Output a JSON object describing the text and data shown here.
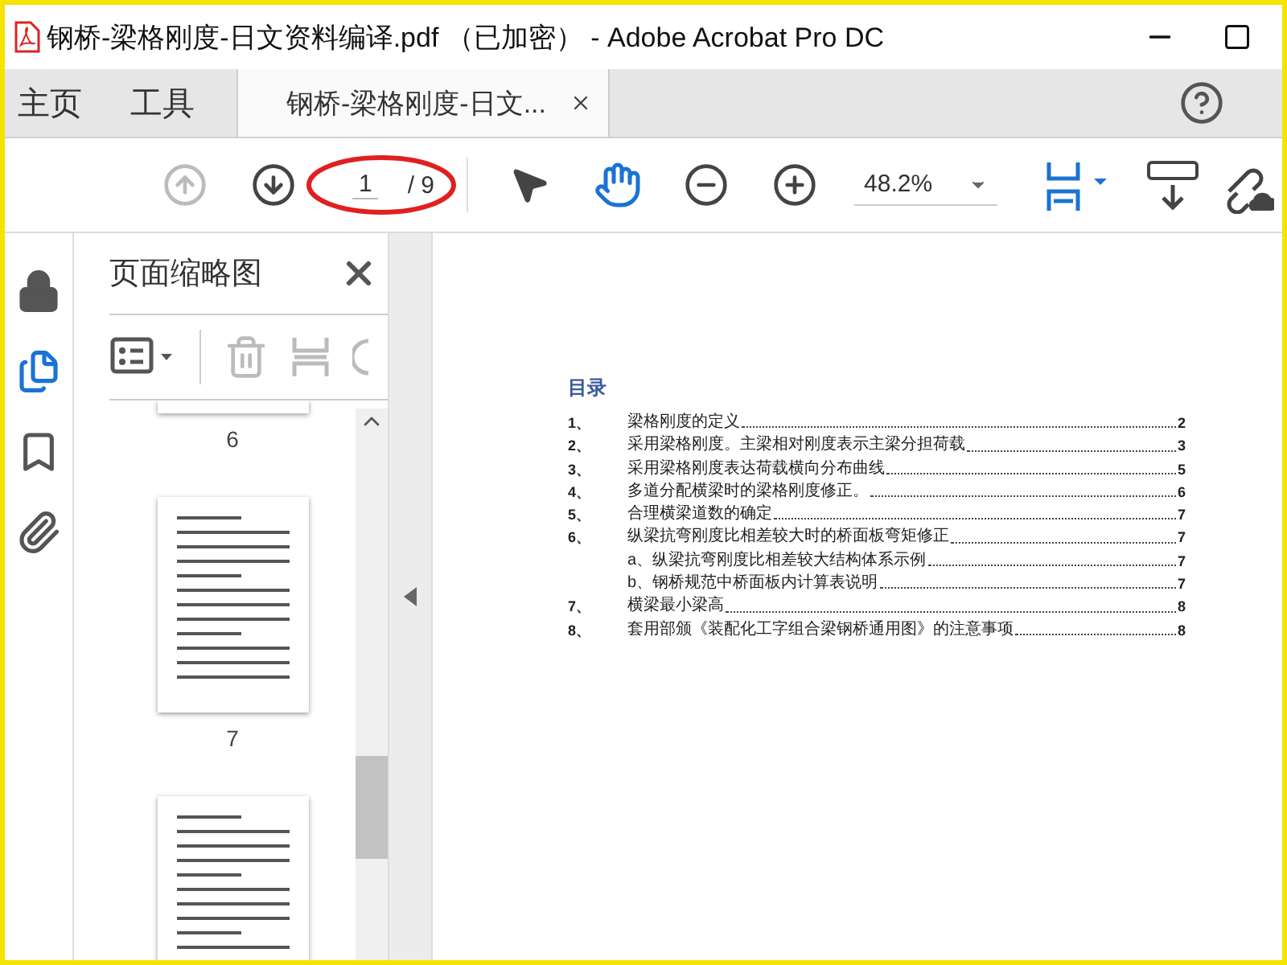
{
  "window": {
    "title": "钢桥-梁格刚度-日文资料编译.pdf （已加密） - Adobe Acrobat Pro DC"
  },
  "nav_tabs": [
    {
      "label": "主页",
      "selected": false
    },
    {
      "label": "工具",
      "selected": false
    },
    {
      "label": "钢桥-梁格刚度-日文...",
      "selected": true,
      "kind": "document"
    }
  ],
  "toolbar": {
    "page_current": "1",
    "page_total": "/ 9",
    "zoom": "48.2%"
  },
  "sidebar_rail": [
    {
      "kind": "lock",
      "selected": false
    },
    {
      "kind": "pages",
      "selected": true
    },
    {
      "kind": "bookmark",
      "selected": false
    },
    {
      "kind": "attachment",
      "selected": false
    }
  ],
  "thumbnails_panel": {
    "title": "页面缩略图",
    "page_labels": [
      "6",
      "7"
    ]
  },
  "document": {
    "heading": "目录",
    "toc": [
      {
        "kind": "main",
        "number": "1、",
        "title": "梁格刚度的定义",
        "page": "2"
      },
      {
        "kind": "main",
        "number": "2、",
        "title": "采用梁格刚度。主梁相对刚度表示主梁分担荷载",
        "page": "3"
      },
      {
        "kind": "main",
        "number": "3、",
        "title": "采用梁格刚度表达荷载横向分布曲线",
        "page": "5"
      },
      {
        "kind": "main",
        "number": "4、",
        "title": "多道分配横梁时的梁格刚度修正。",
        "page": "6"
      },
      {
        "kind": "main",
        "number": "5、",
        "title": "合理横梁道数的确定",
        "page": "7"
      },
      {
        "kind": "main",
        "number": "6、",
        "title": "纵梁抗弯刚度比相差较大时的桥面板弯矩修正",
        "page": "7"
      },
      {
        "kind": "sub",
        "title": "a、纵梁抗弯刚度比相差较大结构体系示例",
        "page": "7"
      },
      {
        "kind": "sub",
        "title": "b、钢桥规范中桥面板内计算表说明",
        "page": "7"
      },
      {
        "kind": "main",
        "number": "7、",
        "title": "横梁最小梁高",
        "page": "8"
      },
      {
        "kind": "main",
        "number": "8、",
        "title": "套用部颁《装配化工字组合梁钢桥通用图》的注意事项",
        "page": "8"
      }
    ]
  }
}
